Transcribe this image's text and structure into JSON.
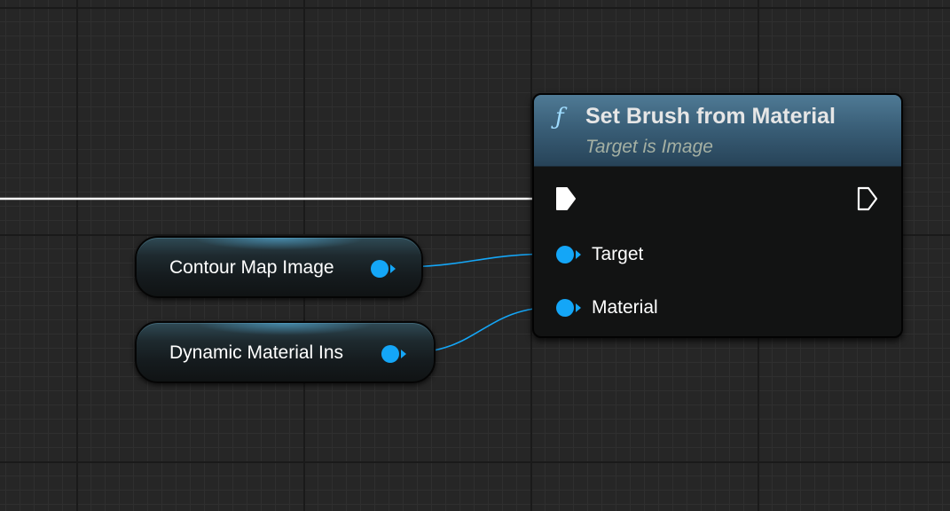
{
  "function_node": {
    "icon": "ƒ",
    "title": "Set Brush from Material",
    "subtitle": "Target is Image",
    "pins": {
      "target": "Target",
      "material": "Material"
    }
  },
  "variable_nodes": [
    {
      "label": "Contour Map Image"
    },
    {
      "label": "Dynamic Material Ins"
    }
  ],
  "colors": {
    "object_pin": "#14a6f7",
    "exec_wire": "#ffffff",
    "header_accent": "#3a5f78",
    "graph_background": "#262626"
  }
}
